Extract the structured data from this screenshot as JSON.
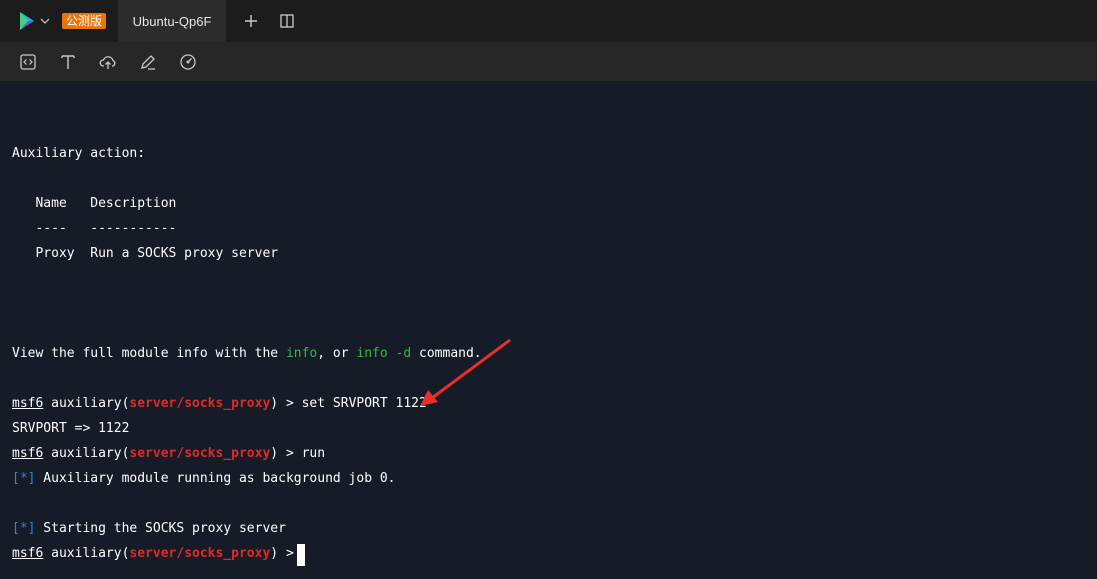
{
  "tabbar": {
    "beta_label": "公测版",
    "tab_title": "Ubuntu-Qp6F",
    "add_tab_icon": "plus-icon",
    "split_icon": "split-view-icon"
  },
  "toolbar": {
    "icons": [
      "code-icon",
      "text-icon",
      "cloud-upload-icon",
      "edit-icon",
      "gauge-icon"
    ]
  },
  "terminal": {
    "aux_action_heading": "Auxiliary action:",
    "table_header": "   Name   Description",
    "table_rule": "   ----   -----------",
    "table_row": "   Proxy  Run a SOCKS proxy server",
    "info_prefix": "View the full module info with the ",
    "info_cmd1": "info",
    "info_mid": ", or ",
    "info_cmd2": "info -d",
    "info_suffix": " command.",
    "prompt_name": "msf6",
    "prompt_pre": " auxiliary(",
    "prompt_module": "server/socks_proxy",
    "prompt_post": ") > ",
    "cmd1": "set SRVPORT 1122",
    "out1": "SRVPORT => 1122",
    "cmd2": "run",
    "status_tag": "[*]",
    "out2": " Auxiliary module running as background job 0.",
    "out3": " Starting the SOCKS proxy server"
  }
}
